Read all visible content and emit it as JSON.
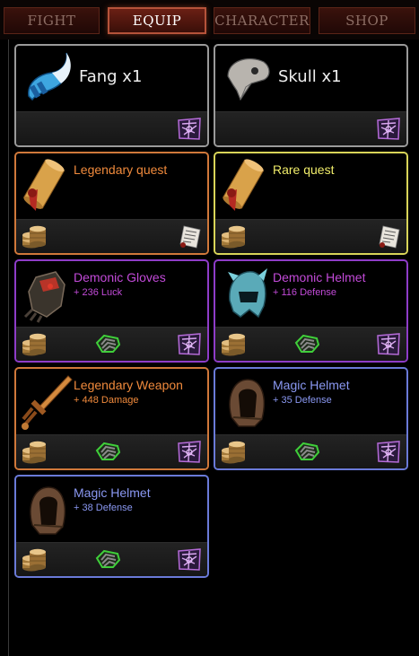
{
  "tabs": [
    {
      "label": "FIGHT",
      "active": false
    },
    {
      "label": "EQUIP",
      "active": true
    },
    {
      "label": "CHARACTER",
      "active": false
    },
    {
      "label": "SHOP",
      "active": false
    }
  ],
  "items": [
    {
      "name": "Fang",
      "qty": "x1",
      "rarity": "material",
      "border": "#9a9a9a",
      "icon": "fang-icon",
      "buttons": [
        "salvage"
      ]
    },
    {
      "name": "Skull",
      "qty": "x1",
      "rarity": "material",
      "border": "#9a9a9a",
      "icon": "skull-icon",
      "buttons": [
        "salvage"
      ]
    },
    {
      "name": "Legendary quest",
      "rarity": "legendary",
      "border": "#d0783a",
      "name_color": "#f08a3c",
      "icon": "scroll-icon",
      "buttons": [
        "coins",
        "scroll"
      ]
    },
    {
      "name": "Rare quest",
      "rarity": "rare",
      "border": "#d8d458",
      "name_color": "#f0ec6a",
      "icon": "scroll-icon",
      "buttons": [
        "coins",
        "scroll"
      ]
    },
    {
      "name": "Demonic Gloves",
      "stat": "+ 236 Luck",
      "rarity": "demonic",
      "border": "#8e3cc8",
      "name_color": "#c24ad8",
      "icon": "gloves-icon",
      "buttons": [
        "coins",
        "equip",
        "salvage"
      ]
    },
    {
      "name": "Demonic Helmet",
      "stat": "+ 116 Defense",
      "rarity": "demonic",
      "border": "#8e3cc8",
      "name_color": "#c24ad8",
      "icon": "helmet-icon",
      "buttons": [
        "coins",
        "equip",
        "salvage"
      ]
    },
    {
      "name": "Legendary Weapon",
      "stat": "+ 448 Damage",
      "rarity": "legendary",
      "border": "#d0783a",
      "name_color": "#f08a3c",
      "icon": "sword-icon",
      "buttons": [
        "coins",
        "equip",
        "salvage"
      ]
    },
    {
      "name": "Magic Helmet",
      "stat": "+ 35 Defense",
      "rarity": "magic",
      "border": "#6a7ad8",
      "name_color": "#8a98f2",
      "icon": "hood-icon",
      "buttons": [
        "coins",
        "equip",
        "salvage"
      ]
    },
    {
      "name": "Magic Helmet",
      "stat": "+ 38 Defense",
      "rarity": "magic",
      "border": "#6a7ad8",
      "name_color": "#8a98f2",
      "icon": "hood-icon",
      "buttons": [
        "coins",
        "equip",
        "salvage"
      ]
    }
  ],
  "colors": {
    "tab_active_border": "#b5533a",
    "tab_text": "#8c6d64",
    "footer": "#1e1e1e"
  }
}
